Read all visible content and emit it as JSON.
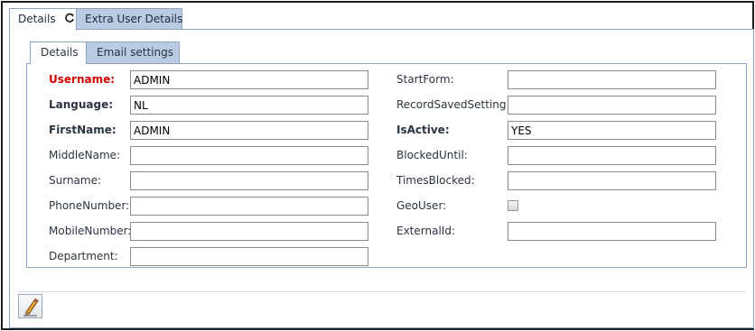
{
  "tabs": {
    "main": {
      "details_label": "Details",
      "extra_label": "Extra User Details"
    },
    "inner": {
      "details_label": "Details",
      "email_label": "Email settings"
    }
  },
  "form": {
    "left": [
      {
        "label": "Username:",
        "value": "ADMIN",
        "style": "required"
      },
      {
        "label": "Language:",
        "value": "NL",
        "style": "bold"
      },
      {
        "label": "FirstName:",
        "value": "ADMIN",
        "style": "bold"
      },
      {
        "label": "MiddleName:",
        "value": "",
        "style": "normal"
      },
      {
        "label": "Surname:",
        "value": "",
        "style": "normal"
      },
      {
        "label": "PhoneNumber:",
        "value": "",
        "style": "normal"
      },
      {
        "label": "MobileNumber:",
        "value": "",
        "style": "normal"
      },
      {
        "label": "Department:",
        "value": "",
        "style": "normal"
      }
    ],
    "right": [
      {
        "label": "StartForm:",
        "value": "",
        "style": "normal",
        "kind": "text"
      },
      {
        "label": "RecordSavedSetting:",
        "value": "",
        "style": "normal",
        "kind": "text"
      },
      {
        "label": "IsActive:",
        "value": "YES",
        "style": "bold",
        "kind": "text"
      },
      {
        "label": "BlockedUntil:",
        "value": "",
        "style": "normal",
        "kind": "text"
      },
      {
        "label": "TimesBlocked:",
        "value": "",
        "style": "normal",
        "kind": "text"
      },
      {
        "label": "GeoUser:",
        "checked": false,
        "style": "normal",
        "kind": "checkbox"
      },
      {
        "label": "ExternalId:",
        "value": "",
        "style": "normal",
        "kind": "text"
      }
    ]
  },
  "toolbar": {
    "edit_icon": "pencil-icon"
  },
  "colors": {
    "tab_inactive": "#b9cbe2",
    "border": "#8da4c2",
    "required": "#d20000"
  }
}
